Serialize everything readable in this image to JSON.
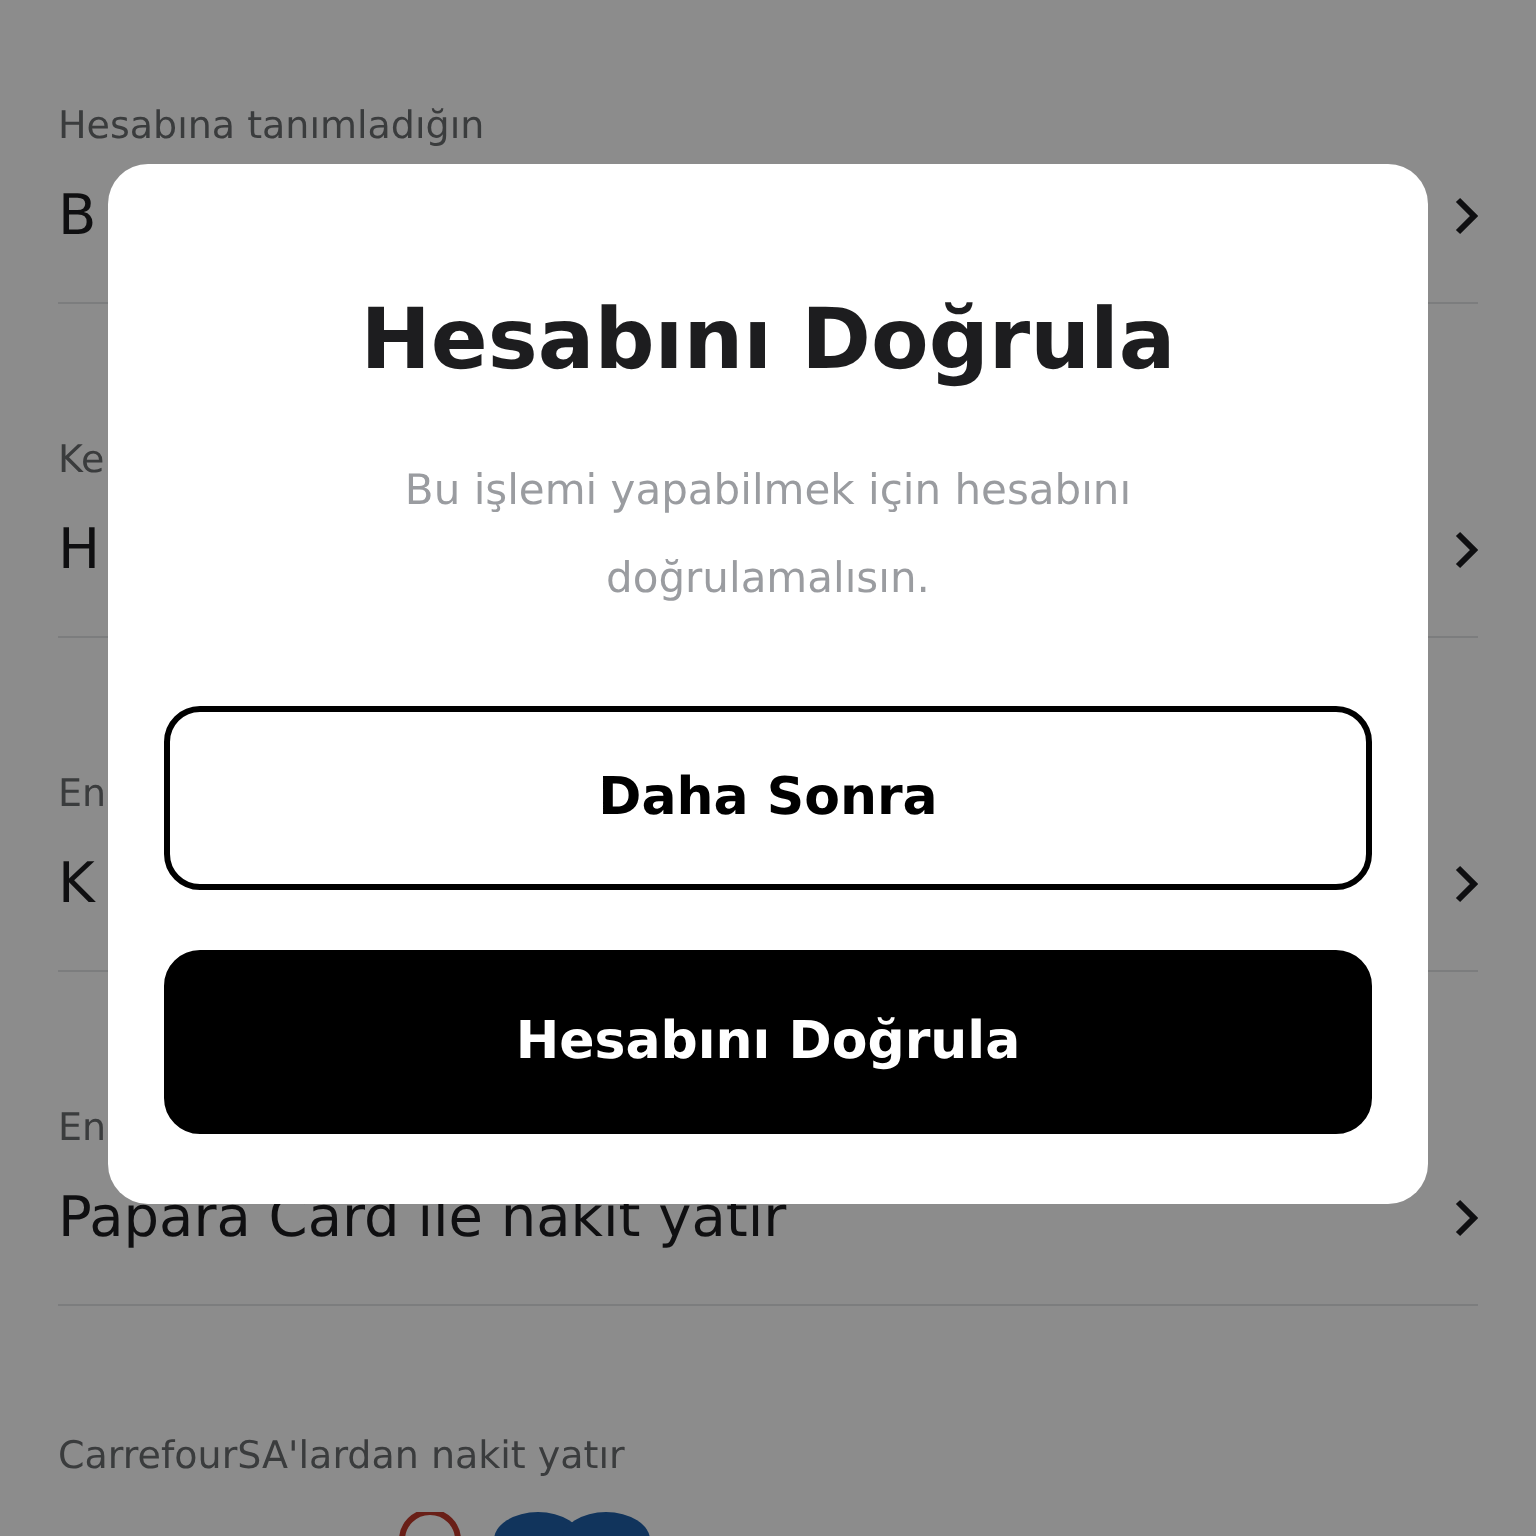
{
  "rows": [
    {
      "label": "Hesabına tanımladığın",
      "title": "B"
    },
    {
      "label": "Ke",
      "title": "H"
    },
    {
      "label": "En",
      "title": "K"
    },
    {
      "label": "En",
      "title": "Papara Card ile nakit yatır"
    }
  ],
  "bottom_section": {
    "label": "CarrefourSA'lardan nakit yatır"
  },
  "modal": {
    "title": "Hesabını Doğrula",
    "message": "Bu işlemi yapabilmek için hesabını doğrulamalısın.",
    "buttons": [
      {
        "label": "Daha Sonra",
        "kind": "secondary"
      },
      {
        "label": "Hesabını Doğrula",
        "kind": "primary"
      }
    ]
  }
}
